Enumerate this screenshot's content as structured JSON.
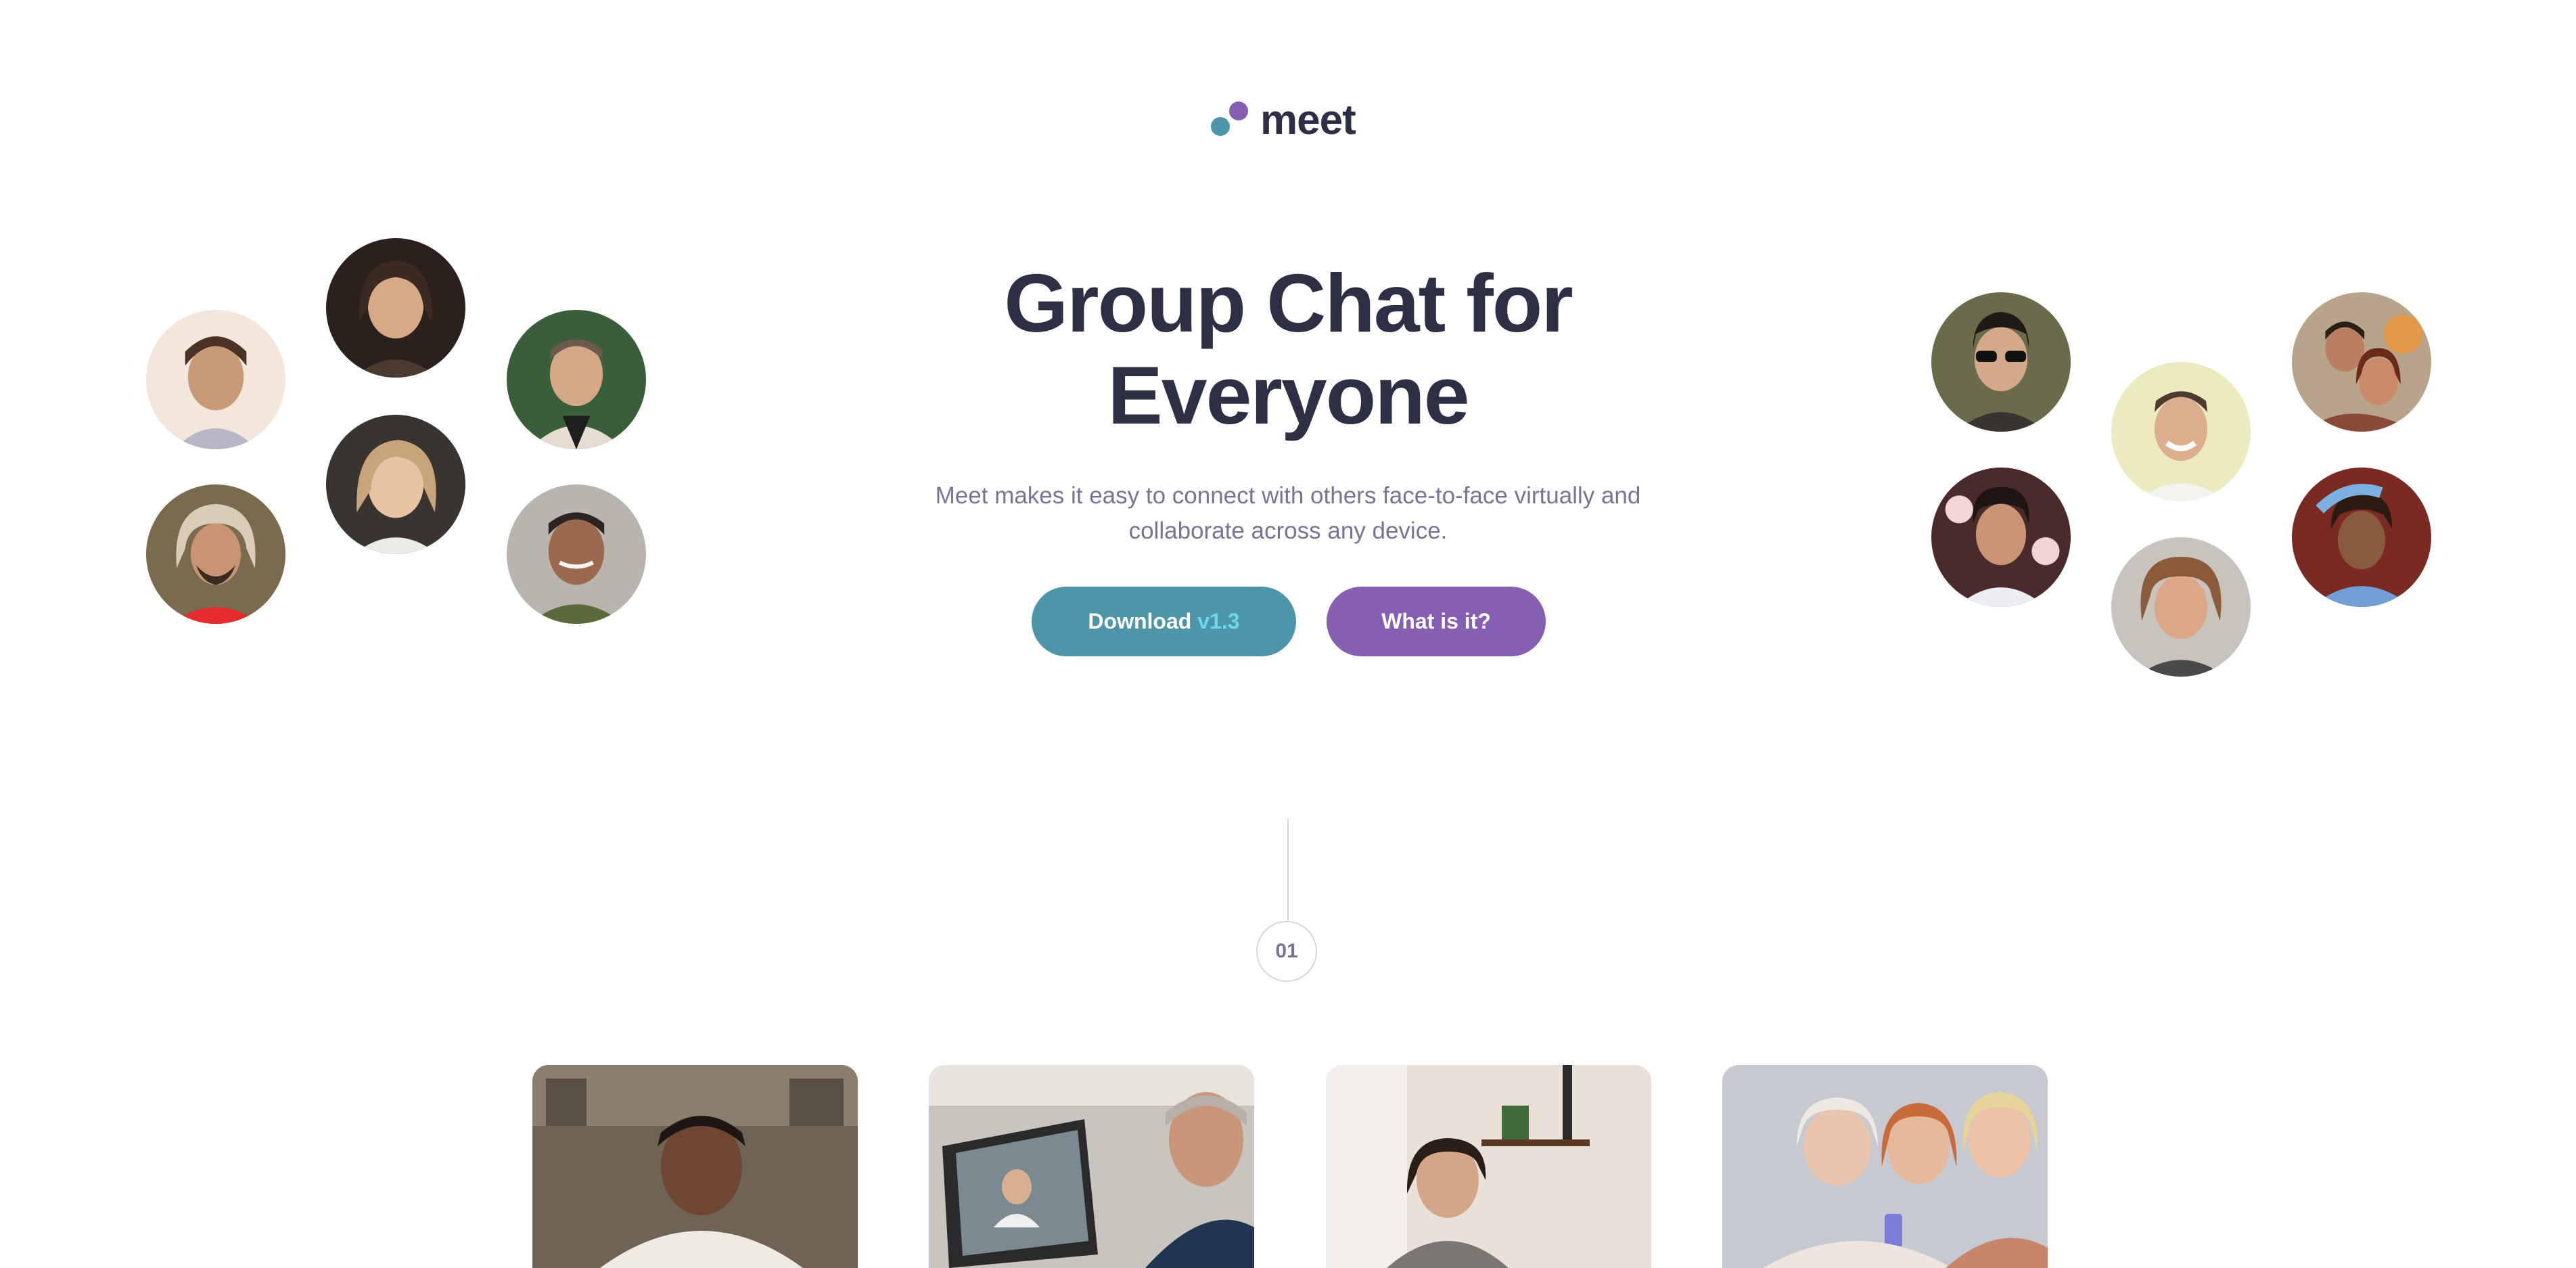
{
  "brand": {
    "name": "meet",
    "colors": {
      "teal": "#4d96a9",
      "purple": "#855fb1",
      "dark": "#2d2f45",
      "muted": "#767596"
    }
  },
  "hero": {
    "title_line1": "Group Chat for",
    "title_line2": "Everyone",
    "subtitle_line1": "Meet makes it easy to connect with others face-to-face virtually and",
    "subtitle_line2": "collaborate across any device."
  },
  "actions": {
    "download_label": "Download",
    "download_version": "v1.3",
    "what_label": "What is it?"
  },
  "step": {
    "number": "01"
  },
  "avatars_left": [
    "person-avatar",
    "person-avatar",
    "person-avatar",
    "person-avatar",
    "person-avatar",
    "person-avatar"
  ],
  "avatars_right": [
    "person-avatar",
    "person-avatar",
    "person-avatar",
    "person-avatar",
    "person-avatar",
    "person-avatar"
  ],
  "cards": [
    "man-with-phone-photo",
    "video-call-laptop-photo",
    "woman-on-headset-photo",
    "women-looking-at-phone-photo"
  ]
}
